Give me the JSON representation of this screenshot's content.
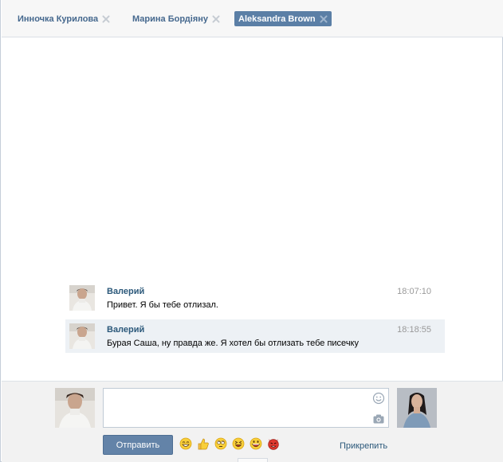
{
  "tabs": [
    {
      "label": "Инночка Курилова",
      "active": false
    },
    {
      "label": "Марина Бордіяну",
      "active": false
    },
    {
      "label": "Aleksandra Brown",
      "active": true
    }
  ],
  "messages": [
    {
      "author": "Валерий",
      "time": "18:07:10",
      "text": "Привет. Я бы тебе отлизал.",
      "highlighted": false
    },
    {
      "author": "Валерий",
      "time": "18:18:55",
      "text": "Бурая Саша, ну правда же. Я хотел бы отлизать тебе писечку",
      "highlighted": true
    }
  ],
  "composer": {
    "message_value": "",
    "send_label": "Отправить",
    "attach_label": "Прикрепить",
    "emojis": [
      "grin-emoji",
      "thumbs-up-emoji",
      "rolling-eyes-emoji",
      "laughing-emoji",
      "big-grin-emoji",
      "devil-emoji"
    ]
  },
  "colors": {
    "accent": "#5b7fa6",
    "link": "#2b587a",
    "button": "#6383a8",
    "highlight_row": "#edf1f5"
  }
}
